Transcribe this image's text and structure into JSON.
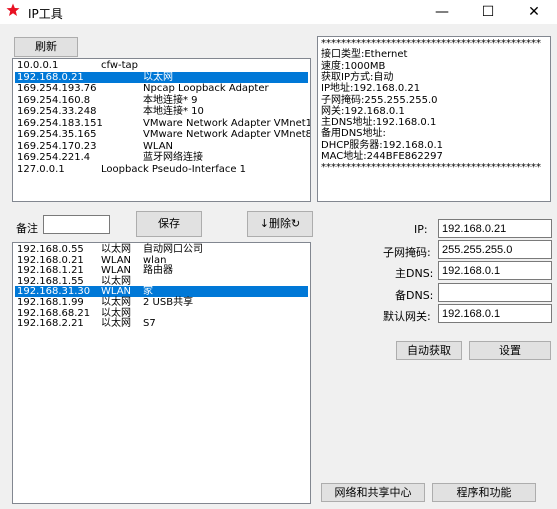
{
  "window": {
    "title": "IP工具",
    "min_glyph": "—",
    "max_glyph": "☐",
    "close_glyph": "✕"
  },
  "top": {
    "refresh_label": "刷新",
    "adapters": [
      {
        "ip": "10.0.0.1",
        "name": "cfw-tap",
        "selected": false
      },
      {
        "ip": "192.168.0.21",
        "name": "以太网",
        "selected": true
      },
      {
        "ip": "169.254.193.76",
        "name": "Npcap Loopback Adapter",
        "selected": false
      },
      {
        "ip": "169.254.160.8",
        "name": "本地连接* 9",
        "selected": false
      },
      {
        "ip": "169.254.33.248",
        "name": "本地连接* 10",
        "selected": false
      },
      {
        "ip": "169.254.183.151",
        "name": "VMware Network Adapter VMnet1",
        "selected": false
      },
      {
        "ip": "169.254.35.165",
        "name": "VMware Network Adapter VMnet8",
        "selected": false
      },
      {
        "ip": "169.254.170.23",
        "name": "WLAN",
        "selected": false
      },
      {
        "ip": "169.254.221.4",
        "name": "蓝牙网络连接",
        "selected": false
      },
      {
        "ip": "127.0.0.1",
        "name": "Loopback Pseudo-Interface 1",
        "selected": false
      }
    ]
  },
  "info": {
    "lines": [
      "********************************************",
      "接口类型:Ethernet",
      "速度:1000MB",
      "获取IP方式:自动",
      "IP地址:192.168.0.21",
      "子网掩码:255.255.255.0",
      "网关:192.168.0.1",
      "主DNS地址:192.168.0.1",
      "备用DNS地址:",
      "DHCP服务器:192.168.0.1",
      "MAC地址:244BFE862297",
      "********************************************"
    ]
  },
  "middle": {
    "note_label": "备注",
    "note_value": "",
    "save_label": "保存",
    "delete_label": "↓删除↻",
    "saved": [
      {
        "ip": "192.168.0.55",
        "iface": "以太网",
        "note": "自动网口公司",
        "selected": false
      },
      {
        "ip": "192.168.0.21",
        "iface": "WLAN",
        "note": "wlan",
        "selected": false
      },
      {
        "ip": "192.168.1.21",
        "iface": "WLAN",
        "note": "路由器",
        "selected": false
      },
      {
        "ip": "192.168.1.55",
        "iface": "以太网",
        "note": "",
        "selected": false
      },
      {
        "ip": "192.168.31.30",
        "iface": "WLAN",
        "note": "家",
        "selected": true
      },
      {
        "ip": "192.168.1.99",
        "iface": "以太网",
        "note": "2 USB共享",
        "selected": false
      },
      {
        "ip": "192.168.68.21",
        "iface": "以太网",
        "note": "",
        "selected": false
      },
      {
        "ip": "192.168.2.21",
        "iface": "以太网",
        "note": "S7",
        "selected": false
      }
    ]
  },
  "form": {
    "ip_label": "IP:",
    "ip_value": "192.168.0.21",
    "mask_label": "子网掩码:",
    "mask_value": "255.255.255.0",
    "dns1_label": "主DNS:",
    "dns1_value": "192.168.0.1",
    "dns2_label": "备DNS:",
    "dns2_value": "",
    "gateway_label": "默认网关:",
    "gateway_value": "192.168.0.1",
    "auto_label": "自动获取",
    "set_label": "设置"
  },
  "bottom": {
    "network_center_label": "网络和共享中心",
    "programs_label": "程序和功能"
  },
  "colors": {
    "selection": "#0078d7",
    "icon": "#e81123"
  }
}
